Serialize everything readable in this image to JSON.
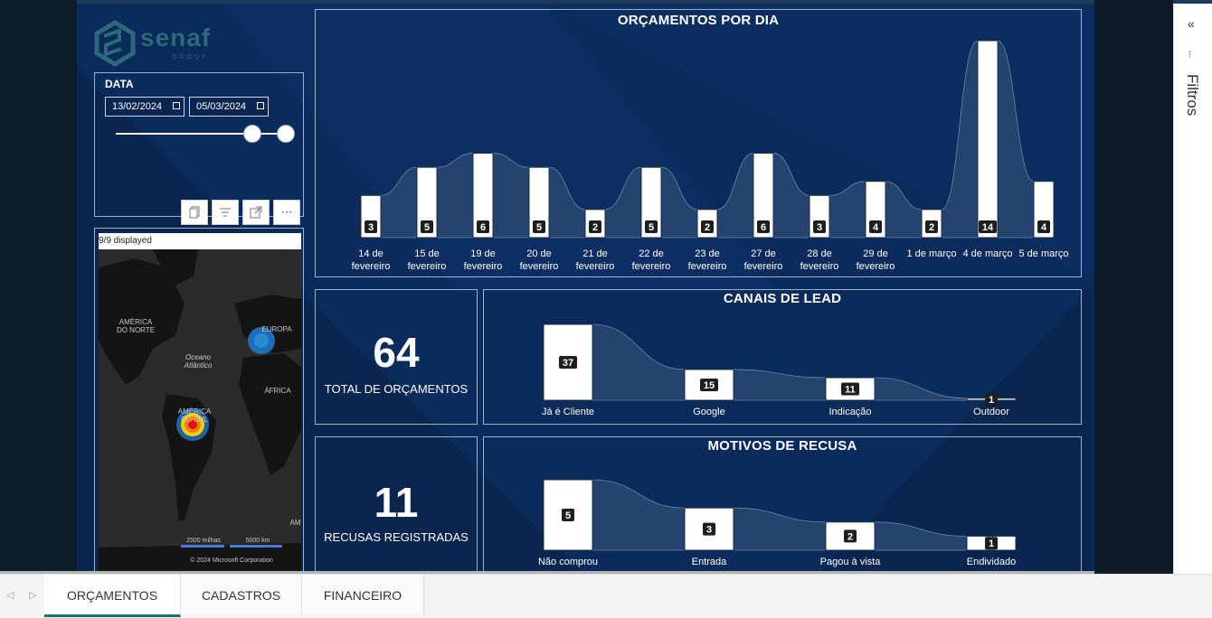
{
  "logo": {
    "name": "senaf",
    "sub": "GROUP"
  },
  "date_filter": {
    "label": "DATA",
    "start": "13/02/2024",
    "end": "05/03/2024"
  },
  "toolbar": {
    "copy": "copy-icon",
    "filter": "filter-icon",
    "focus": "expand-icon",
    "more": "⋯"
  },
  "map": {
    "displayed": "9/9 displayed",
    "labels": {
      "north_america": "AMÉRICA DO NORTE",
      "ocean": "Oceano Atlântico",
      "europe": "EUROPA",
      "africa": "ÁFRICA",
      "south_america": "AMÉRICA DO SUL",
      "asia": "AM"
    },
    "scale_miles": "2500 milhas",
    "scale_km": "5000 km",
    "copyright": "© 2024 Microsoft Corporation"
  },
  "kpi": {
    "total": {
      "value": "64",
      "label": "TOTAL DE ORÇAMENTOS"
    },
    "refusals": {
      "value": "11",
      "label": "RECUSAS REGISTRADAS"
    }
  },
  "tabs": [
    "ORÇAMENTOS",
    "CADASTROS",
    "FINANCEIRO"
  ],
  "filters_label": "Filtros",
  "colors": {
    "canvas": "#0a2550",
    "accent": "#117865",
    "ribbon": "#2b4a74"
  },
  "chart_data": [
    {
      "type": "bar",
      "title": "ORÇAMENTOS POR DIA",
      "categories": [
        "14 de fevereiro",
        "15 de fevereiro",
        "19 de fevereiro",
        "20 de fevereiro",
        "21 de fevereiro",
        "22 de fevereiro",
        "23 de fevereiro",
        "27 de fevereiro",
        "28 de fevereiro",
        "29 de fevereiro",
        "1 de março",
        "4 de março",
        "5 de março"
      ],
      "values": [
        3,
        5,
        6,
        5,
        2,
        5,
        2,
        6,
        3,
        4,
        2,
        14,
        4
      ],
      "ylim": [
        0,
        14
      ]
    },
    {
      "type": "bar",
      "title": "CANAIS DE LEAD",
      "categories": [
        "Já é Cliente",
        "Google",
        "Indicação",
        "Outdoor"
      ],
      "values": [
        37,
        15,
        11,
        1
      ]
    },
    {
      "type": "bar",
      "title": "MOTIVOS DE RECUSA",
      "categories": [
        "Não comprou",
        "Entrada",
        "Pagou à vista",
        "Endividado"
      ],
      "values": [
        5,
        3,
        2,
        1
      ]
    }
  ]
}
